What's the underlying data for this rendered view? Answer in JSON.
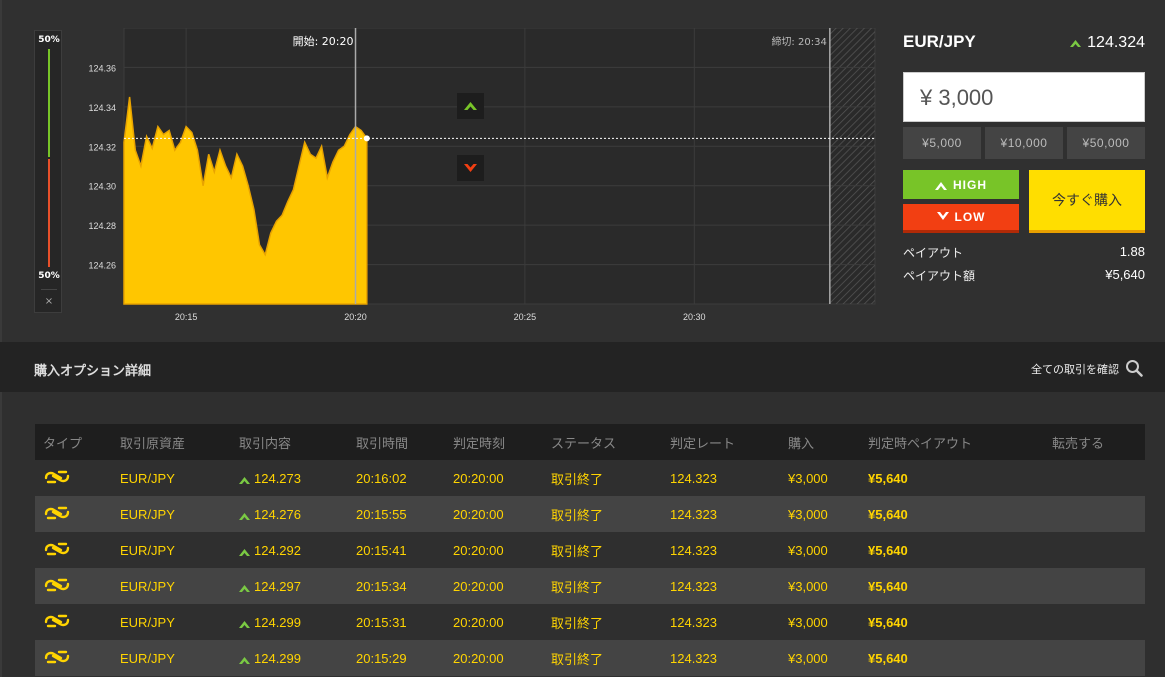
{
  "gauge": {
    "top_pct": "50%",
    "bottom_pct": "50%",
    "close": "×"
  },
  "chart": {
    "start_label": "開始: 20:20",
    "end_label": "締切: 20:34"
  },
  "chart_data": {
    "type": "area",
    "xlabel": "",
    "ylabel": "",
    "xticks": [
      "20:15",
      "20:20",
      "20:25",
      "20:30"
    ],
    "yticks": [
      "124.36",
      "124.34",
      "124.32",
      "124.30",
      "124.28",
      "124.26"
    ],
    "ylim": [
      124.24,
      124.38
    ],
    "xlim": [
      "20:13:10",
      "20:35:20"
    ],
    "current_rate": 124.324,
    "series": [
      {
        "x": [
          "20:13:10",
          "20:13:20",
          "20:13:30",
          "20:13:40",
          "20:13:50",
          "20:14:00",
          "20:14:10",
          "20:14:20",
          "20:14:30",
          "20:14:40",
          "20:14:50",
          "20:15:00",
          "20:15:10",
          "20:15:20",
          "20:15:30",
          "20:15:40",
          "20:15:50",
          "20:16:00",
          "20:16:10",
          "20:16:20",
          "20:16:30",
          "20:16:40",
          "20:16:50",
          "20:17:00",
          "20:17:10",
          "20:17:20",
          "20:17:30",
          "20:17:40",
          "20:17:50",
          "20:18:00",
          "20:18:10",
          "20:18:20",
          "20:18:30",
          "20:18:40",
          "20:18:50",
          "20:19:00",
          "20:19:10",
          "20:19:20",
          "20:19:30",
          "20:19:40",
          "20:19:50",
          "20:20:00",
          "20:20:10",
          "20:20:20"
        ],
        "y": [
          124.322,
          124.345,
          124.318,
          124.31,
          124.325,
          124.319,
          124.33,
          124.326,
          124.328,
          124.318,
          124.322,
          124.33,
          124.327,
          124.318,
          124.3,
          124.316,
          124.307,
          124.318,
          124.31,
          124.304,
          124.316,
          124.31,
          124.3,
          124.288,
          124.27,
          124.265,
          124.276,
          124.282,
          124.285,
          124.292,
          124.298,
          124.31,
          124.322,
          124.316,
          124.314,
          124.32,
          124.304,
          124.312,
          124.318,
          124.32,
          124.326,
          124.33,
          124.328,
          124.324
        ]
      }
    ]
  },
  "panel": {
    "pair": "EUR/JPY",
    "rate": "124.324",
    "amount": "¥ 3,000",
    "presets": [
      "¥5,000",
      "¥10,000",
      "¥50,000"
    ],
    "high": "HIGH",
    "low": "LOW",
    "buy": "今すぐ購入",
    "payout_label": "ペイアウト",
    "payout_value": "1.88",
    "payout_amount_label": "ペイアウト額",
    "payout_amount_value": "¥5,640"
  },
  "section": {
    "title": "購入オプション詳細",
    "link": "全ての取引を確認"
  },
  "table": {
    "headers": [
      "タイプ",
      "取引原資産",
      "取引内容",
      "取引時間",
      "判定時刻",
      "ステータス",
      "判定レート",
      "購入",
      "判定時ペイアウト",
      "転売する"
    ],
    "rows": [
      {
        "asset": "EUR/JPY",
        "content": "124.273",
        "time": "20:16:02",
        "judge": "20:20:00",
        "status": "取引終了",
        "rate": "124.323",
        "buy": "¥3,000",
        "payout": "¥5,640",
        "resell": ""
      },
      {
        "asset": "EUR/JPY",
        "content": "124.276",
        "time": "20:15:55",
        "judge": "20:20:00",
        "status": "取引終了",
        "rate": "124.323",
        "buy": "¥3,000",
        "payout": "¥5,640",
        "resell": ""
      },
      {
        "asset": "EUR/JPY",
        "content": "124.292",
        "time": "20:15:41",
        "judge": "20:20:00",
        "status": "取引終了",
        "rate": "124.323",
        "buy": "¥3,000",
        "payout": "¥5,640",
        "resell": ""
      },
      {
        "asset": "EUR/JPY",
        "content": "124.297",
        "time": "20:15:34",
        "judge": "20:20:00",
        "status": "取引終了",
        "rate": "124.323",
        "buy": "¥3,000",
        "payout": "¥5,640",
        "resell": ""
      },
      {
        "asset": "EUR/JPY",
        "content": "124.299",
        "time": "20:15:31",
        "judge": "20:20:00",
        "status": "取引終了",
        "rate": "124.323",
        "buy": "¥3,000",
        "payout": "¥5,640",
        "resell": ""
      },
      {
        "asset": "EUR/JPY",
        "content": "124.299",
        "time": "20:15:29",
        "judge": "20:20:00",
        "status": "取引終了",
        "rate": "124.323",
        "buy": "¥3,000",
        "payout": "¥5,640",
        "resell": ""
      }
    ]
  },
  "colors": {
    "area": "#ffc600",
    "high": "#78c428",
    "low": "#f23f12",
    "buy": "#ffde00",
    "value_text": "#ffd400"
  }
}
